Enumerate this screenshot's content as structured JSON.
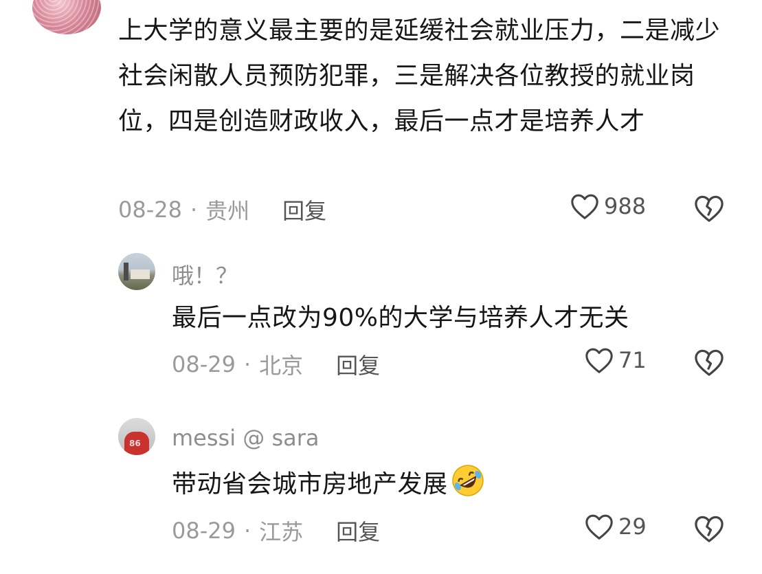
{
  "main_comment": {
    "text": "上大学的意义最主要的是延缓社会就业压力，二是减少社会闲散人员预防犯罪，三是解决各位教授的就业岗位，四是创造财政收入，最后一点才是培养人才",
    "date": "08-28",
    "location": "贵州",
    "reply_label": "回复",
    "likes": "988"
  },
  "replies": [
    {
      "username": "哦！？",
      "text": "最后一点改为90%的大学与培养人才无关",
      "date": "08-29",
      "location": "北京",
      "reply_label": "回复",
      "likes": "71"
    },
    {
      "username": "messi @ sara",
      "text": "带动省会城市房地产发展",
      "emoji": "rolling-on-floor-laughing-emoji",
      "date": "08-29",
      "location": "江苏",
      "reply_label": "回复",
      "likes": "29"
    }
  ],
  "separator": "·",
  "icons": {
    "like": "heart-outline-icon",
    "dislike": "broken-heart-icon"
  },
  "colors": {
    "text": "#161616",
    "meta": "#9a9a9a",
    "reply": "#555555",
    "icon": "#444444"
  }
}
